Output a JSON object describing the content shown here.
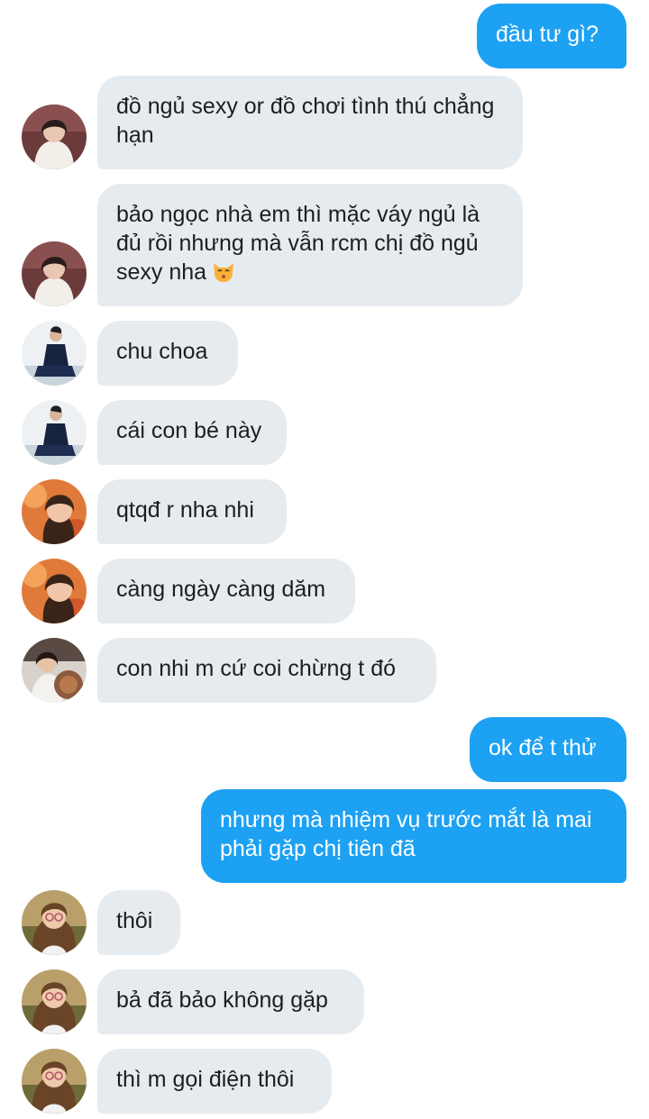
{
  "messages": [
    {
      "side": "out",
      "text": "đầu tư gì?"
    },
    {
      "side": "in",
      "text": "đồ ngủ sexy or đồ chơi tình thú chẳng hạn",
      "avatar": "contact-a"
    },
    {
      "side": "in",
      "text": "bảo ngọc nhà em thì mặc váy ngủ là đủ rồi nhưng mà vẫn rcm chị đồ ngủ sexy nha",
      "emoji": "kissing-cat-emoji",
      "avatar": "contact-a"
    },
    {
      "side": "in",
      "text": "chu choa",
      "avatar": "contact-b"
    },
    {
      "side": "in",
      "text": "cái con bé này",
      "avatar": "contact-b"
    },
    {
      "side": "in",
      "text": "qtqđ r nha nhi",
      "avatar": "contact-c"
    },
    {
      "side": "in",
      "text": "càng ngày càng dăm",
      "avatar": "contact-c"
    },
    {
      "side": "in",
      "text": "con nhi m cứ coi chừng t đó",
      "avatar": "contact-d"
    },
    {
      "side": "out",
      "text": "ok để t thử"
    },
    {
      "side": "out",
      "text": "nhưng mà nhiệm vụ trước mắt là mai phải gặp chị tiên đã"
    },
    {
      "side": "in",
      "text": "thôi",
      "avatar": "contact-e"
    },
    {
      "side": "in",
      "text": "bả đã bảo không gặp",
      "avatar": "contact-e"
    },
    {
      "side": "in",
      "text": "thì m gọi điện thôi",
      "avatar": "contact-e"
    }
  ],
  "colors": {
    "incoming_bubble": "#e6ebf0",
    "outgoing_bubble": "#1da1f2",
    "incoming_text": "#1c1e21",
    "outgoing_text": "#ffffff"
  }
}
